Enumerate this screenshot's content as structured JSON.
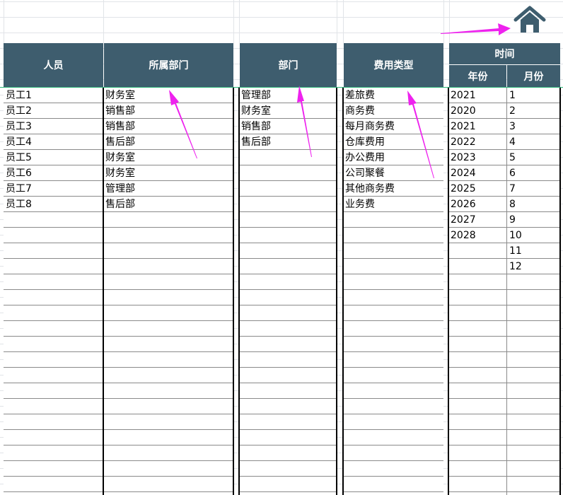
{
  "colors": {
    "header": "#3e5d6e",
    "arrow": "#ee22ee",
    "accent_line": "#2fb67a"
  },
  "home_icon": "home-icon",
  "headers": {
    "person": "人员",
    "person_dept": "所属部门",
    "dept": "部门",
    "expense_type": "费用类型",
    "time": "时间",
    "year": "年份",
    "month": "月份"
  },
  "persons": [
    "员工1",
    "员工2",
    "员工3",
    "员工4",
    "员工5",
    "员工6",
    "员工7",
    "员工8"
  ],
  "person_depts": [
    "财务室",
    "销售部",
    "销售部",
    "售后部",
    "财务室",
    "财务室",
    "管理部",
    "售后部"
  ],
  "depts": [
    "管理部",
    "财务室",
    "销售部",
    "售后部"
  ],
  "expense_types": [
    "差旅费",
    "商务费",
    "每月商务费",
    "仓库费用",
    "办公费用",
    "公司聚餐",
    "其他商务费",
    "业务费"
  ],
  "years": [
    "2021",
    "2020",
    "2021",
    "2022",
    "2023",
    "2024",
    "2025",
    "2026",
    "2027",
    "2028"
  ],
  "months": [
    "1",
    "2",
    "3",
    "4",
    "5",
    "6",
    "7",
    "8",
    "9",
    "10",
    "11",
    "12"
  ]
}
